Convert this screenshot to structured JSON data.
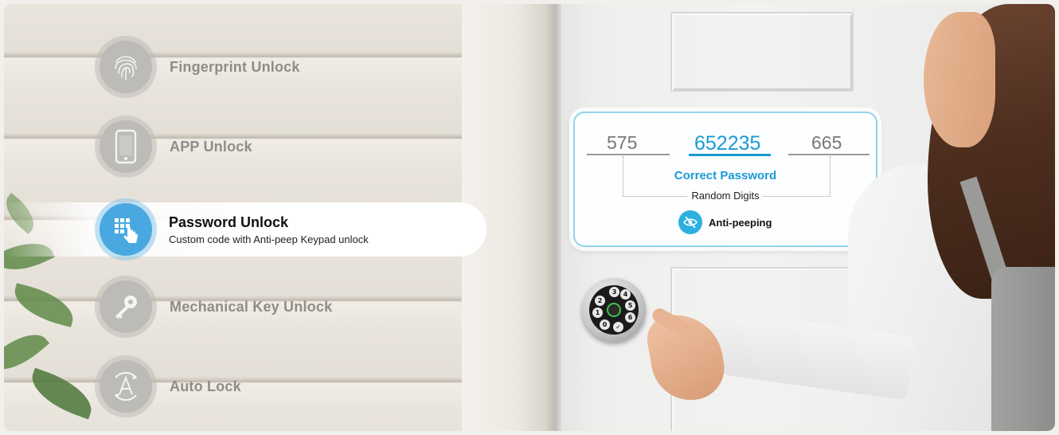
{
  "features": [
    {
      "label": "Fingerprint Unlock",
      "icon": "fingerprint-icon",
      "active": false
    },
    {
      "label": "APP Unlock",
      "icon": "phone-icon",
      "active": false
    },
    {
      "label": "Password Unlock",
      "subtitle": "Custom code with Anti-peep Keypad unlock",
      "icon": "keypad-icon",
      "active": true
    },
    {
      "label": "Mechanical Key Unlock",
      "icon": "key-icon",
      "active": false
    },
    {
      "label": "Auto Lock",
      "icon": "auto-lock-icon",
      "active": false
    }
  ],
  "password_card": {
    "left_digits": "575",
    "main_digits": "652235",
    "right_digits": "665",
    "correct_label": "Correct Password",
    "random_label": "Random Digits",
    "anti_label": "Anti-peeping"
  },
  "keypad": {
    "keys": [
      "3",
      "4",
      "2",
      "5",
      "1",
      "6",
      "0",
      "✓"
    ]
  },
  "colors": {
    "accent": "#1a9ad4",
    "active_icon": "#4aa8e0",
    "card_border": "#8fd3ea"
  }
}
